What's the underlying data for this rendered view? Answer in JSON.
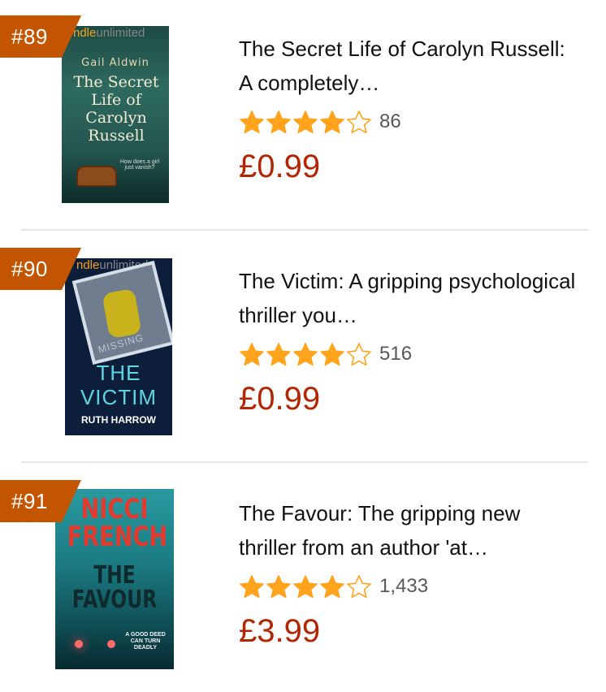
{
  "items": [
    {
      "rank": "#89",
      "title": "The Secret Life of Carolyn Russell: A completely…",
      "rating": 4.5,
      "review_count": "86",
      "price": "£0.99",
      "cover": {
        "badge_prefix": "ndle",
        "badge_suffix": "unlimited",
        "author": "Gail Aldwin",
        "title": "The Secret Life of Carolyn Russell",
        "tagline": "How does a girl just vanish?"
      }
    },
    {
      "rank": "#90",
      "title": "The Victim: A gripping psychological thriller you…",
      "rating": 4.5,
      "review_count": "516",
      "price": "£0.99",
      "cover": {
        "badge_prefix": "ndle",
        "badge_suffix": "unlimited",
        "stamp": "MISSING",
        "title": "THE VICTIM",
        "author": "RUTH HARROW"
      }
    },
    {
      "rank": "#91",
      "title": "The Favour: The gripping new thriller from an author 'at…",
      "rating": 4.5,
      "review_count": "1,433",
      "price": "£3.99",
      "cover": {
        "author": "NICCI FRENCH",
        "title": "THE FAVOUR",
        "tagline": "A GOOD DEED CAN TURN DEADLY"
      }
    }
  ],
  "colors": {
    "rank_badge": "#c45500",
    "star": "#ffa41c",
    "price": "#b12704",
    "count": "#565959"
  },
  "icons": {
    "full_star": "star-filled-icon",
    "empty_star": "star-outline-icon"
  }
}
